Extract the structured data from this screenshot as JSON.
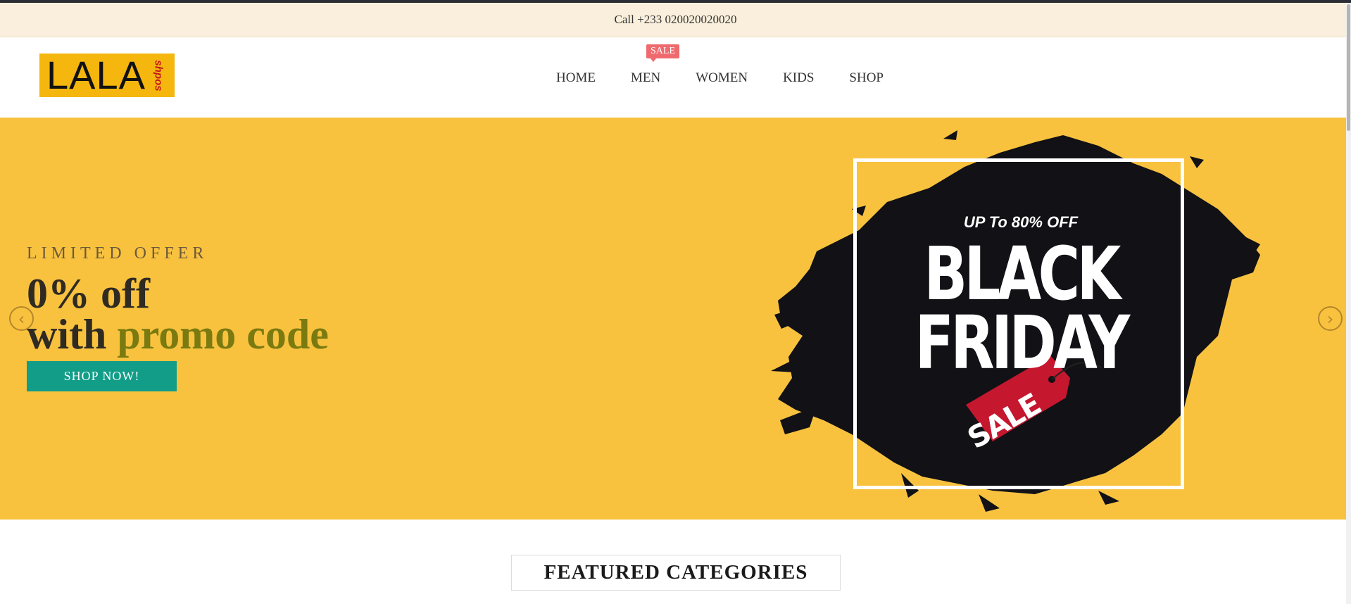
{
  "topbar": {
    "phone_text": "Call +233 020020020020"
  },
  "brand": {
    "name": "LALA",
    "subname": "shpos",
    "color": "#f5b70e"
  },
  "nav": {
    "items": [
      {
        "label": "HOME"
      },
      {
        "label": "MEN",
        "badge": "SALE"
      },
      {
        "label": "WOMEN"
      },
      {
        "label": "KIDS"
      },
      {
        "label": "SHOP"
      }
    ]
  },
  "hero": {
    "eyebrow": "LIMITED OFFER",
    "headline_line1": "0% off",
    "headline_line2_prefix": "with ",
    "headline_line2_accent": "promo code",
    "cta_label": "SHOP NOW!",
    "background": "#f8c23f",
    "accent_color": "#7a7a10",
    "cta_color": "#119d88",
    "left_arrow_icon": "chevron-left-icon",
    "right_arrow_icon": "chevron-right-icon"
  },
  "promo_banner": {
    "upto": "UP To 80% OFF",
    "line1": "BLACK",
    "line2": "FRIDAY",
    "tag": "SALE",
    "tag_color": "#c5172e"
  },
  "section": {
    "title": "FEATURED CATEGORIES"
  }
}
